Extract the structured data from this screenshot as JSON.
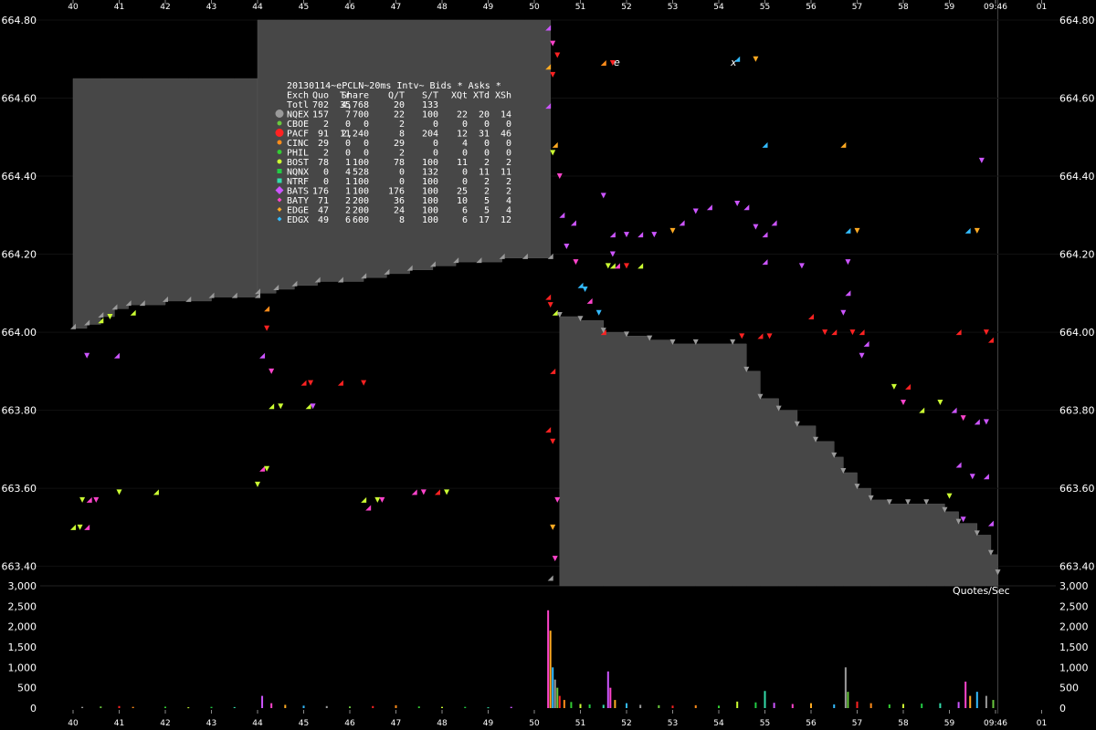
{
  "chart_data": {
    "type": "scatter",
    "x_ticks": [
      "40",
      "41",
      "42",
      "43",
      "44",
      "45",
      "46",
      "47",
      "48",
      "49",
      "50",
      "51",
      "52",
      "53",
      "54",
      "55",
      "56",
      "57",
      "58",
      "59",
      "09:46",
      "01"
    ],
    "price_ticks": [
      "664.80",
      "664.60",
      "664.40",
      "664.20",
      "664.00",
      "663.80",
      "663.60",
      "663.40"
    ],
    "volume_ticks": [
      "3,000",
      "2,500",
      "2,000",
      "1,500",
      "1,000",
      "500",
      "0"
    ],
    "price_range": [
      663.35,
      664.8
    ],
    "volume_range": [
      0,
      3000
    ],
    "volume_label": "Quotes/Sec",
    "watermark": [
      "e",
      "x"
    ],
    "exchange_colors": {
      "NQEX": "#9a9a9a",
      "CBOE": "#6ac83e",
      "PACF": "#ff2222",
      "CINC": "#ff8c1a",
      "PHIL": "#33cc33",
      "BOST": "#ccff33",
      "NQNX": "#22cc44",
      "NTRF": "#33ddaa",
      "BATS": "#cc55ff",
      "BATY": "#ff44cc",
      "EDGE": "#ffaa22",
      "EDGX": "#33bbff"
    },
    "legend": {
      "title": "20130114~ePCLN~20ms Intv~ Bids * Asks *",
      "header": [
        "Exch",
        "Quo",
        "Tr",
        "Share",
        "Q/T",
        "S/T",
        "XQt",
        "XTd",
        "XSh"
      ],
      "total": [
        "Totl",
        "702",
        "35",
        "4,768",
        "20",
        "133",
        "",
        "",
        ""
      ],
      "rows": [
        [
          "NQEX",
          "157",
          "7",
          "700",
          "22",
          "100",
          "22",
          "20",
          "14"
        ],
        [
          "CBOE",
          "2",
          "0",
          "0",
          "2",
          "0",
          "0",
          "0",
          "0"
        ],
        [
          "PACF",
          "91",
          "11",
          "2,240",
          "8",
          "204",
          "12",
          "31",
          "46"
        ],
        [
          "CINC",
          "29",
          "0",
          "0",
          "29",
          "0",
          "4",
          "0",
          "0"
        ],
        [
          "PHIL",
          "2",
          "0",
          "0",
          "2",
          "0",
          "0",
          "0",
          "0"
        ],
        [
          "BOST",
          "78",
          "1",
          "100",
          "78",
          "100",
          "11",
          "2",
          "2"
        ],
        [
          "NQNX",
          "0",
          "4",
          "528",
          "0",
          "132",
          "0",
          "11",
          "11"
        ],
        [
          "NTRF",
          "0",
          "1",
          "100",
          "0",
          "100",
          "0",
          "2",
          "2"
        ],
        [
          "BATS",
          "176",
          "1",
          "100",
          "176",
          "100",
          "25",
          "2",
          "2"
        ],
        [
          "BATY",
          "71",
          "2",
          "200",
          "36",
          "100",
          "10",
          "5",
          "4"
        ],
        [
          "EDGE",
          "47",
          "2",
          "200",
          "24",
          "100",
          "6",
          "5",
          "4"
        ],
        [
          "EDGX",
          "49",
          "6",
          "600",
          "8",
          "100",
          "6",
          "17",
          "12"
        ]
      ]
    },
    "spread_left": [
      [
        40.0,
        664.01,
        664.65
      ],
      [
        40.3,
        664.02,
        664.65
      ],
      [
        40.6,
        664.04,
        664.65
      ],
      [
        40.9,
        664.06,
        664.65
      ],
      [
        41.2,
        664.07,
        664.65
      ],
      [
        41.5,
        664.07,
        664.65
      ],
      [
        42.0,
        664.08,
        664.65
      ],
      [
        42.5,
        664.08,
        664.65
      ],
      [
        43.0,
        664.09,
        664.65
      ],
      [
        43.5,
        664.09,
        664.65
      ],
      [
        44.0,
        664.09,
        664.65
      ]
    ],
    "spread_mid": [
      [
        44.0,
        664.1,
        664.8
      ],
      [
        44.4,
        664.11,
        664.8
      ],
      [
        44.8,
        664.12,
        664.8
      ],
      [
        45.3,
        664.13,
        664.8
      ],
      [
        45.8,
        664.13,
        664.8
      ],
      [
        46.3,
        664.14,
        664.8
      ],
      [
        46.8,
        664.15,
        664.8
      ],
      [
        47.3,
        664.16,
        664.8
      ],
      [
        47.8,
        664.17,
        664.8
      ],
      [
        48.3,
        664.18,
        664.8
      ],
      [
        48.8,
        664.18,
        664.8
      ],
      [
        49.3,
        664.19,
        664.8
      ],
      [
        49.8,
        664.19,
        664.8
      ],
      [
        50.35,
        664.19,
        664.8
      ]
    ],
    "spread_right": [
      [
        50.55,
        663.35,
        664.04
      ],
      [
        51.0,
        663.35,
        664.03
      ],
      [
        51.5,
        663.35,
        664.0
      ],
      [
        52.0,
        663.35,
        663.99
      ],
      [
        52.5,
        663.35,
        663.98
      ],
      [
        53.0,
        663.35,
        663.97
      ],
      [
        53.5,
        663.35,
        663.97
      ],
      [
        54.3,
        663.35,
        663.97
      ],
      [
        54.6,
        663.35,
        663.9
      ],
      [
        54.9,
        663.35,
        663.83
      ],
      [
        55.3,
        663.35,
        663.8
      ],
      [
        55.7,
        663.35,
        663.76
      ],
      [
        56.1,
        663.35,
        663.72
      ],
      [
        56.5,
        663.35,
        663.68
      ],
      [
        56.7,
        663.35,
        663.64
      ],
      [
        57.0,
        663.35,
        663.6
      ],
      [
        57.3,
        663.35,
        663.57
      ],
      [
        57.7,
        663.35,
        663.56
      ],
      [
        58.1,
        663.35,
        663.56
      ],
      [
        58.5,
        663.35,
        663.56
      ],
      [
        58.9,
        663.35,
        663.54
      ],
      [
        59.2,
        663.35,
        663.51
      ],
      [
        59.6,
        663.35,
        663.48
      ],
      [
        59.9,
        663.35,
        663.43
      ],
      [
        60.05,
        663.35,
        663.38
      ]
    ],
    "quotes": [
      [
        40.0,
        663.5,
        "BOST"
      ],
      [
        40.15,
        663.5,
        "BOST"
      ],
      [
        40.3,
        663.5,
        "BATY"
      ],
      [
        40.2,
        663.57,
        "BOST"
      ],
      [
        40.35,
        663.57,
        "BATY"
      ],
      [
        40.5,
        663.57,
        "BATY"
      ],
      [
        40.6,
        664.03,
        "BOST"
      ],
      [
        40.8,
        664.04,
        "BOST"
      ],
      [
        41.3,
        664.05,
        "BOST"
      ],
      [
        40.3,
        663.94,
        "BATS"
      ],
      [
        40.95,
        663.94,
        "BATS"
      ],
      [
        41.0,
        663.59,
        "BOST"
      ],
      [
        41.8,
        663.59,
        "BOST"
      ],
      [
        44.0,
        663.61,
        "BOST"
      ],
      [
        44.1,
        663.65,
        "BATY"
      ],
      [
        44.2,
        663.65,
        "BOST"
      ],
      [
        44.1,
        663.94,
        "BATS"
      ],
      [
        44.2,
        664.01,
        "PACF"
      ],
      [
        44.2,
        664.06,
        "CINC"
      ],
      [
        44.3,
        663.9,
        "BATY"
      ],
      [
        44.3,
        663.81,
        "BOST"
      ],
      [
        44.5,
        663.81,
        "BOST"
      ],
      [
        45.1,
        663.81,
        "BOST"
      ],
      [
        45.2,
        663.81,
        "BATS"
      ],
      [
        45.0,
        663.87,
        "PACF"
      ],
      [
        45.15,
        663.87,
        "PACF"
      ],
      [
        45.8,
        663.87,
        "PACF"
      ],
      [
        46.3,
        663.87,
        "PACF"
      ],
      [
        46.3,
        663.57,
        "BOST"
      ],
      [
        46.6,
        663.57,
        "BOST"
      ],
      [
        46.4,
        663.55,
        "BATY"
      ],
      [
        46.7,
        663.57,
        "BATY"
      ],
      [
        47.4,
        663.59,
        "BATY"
      ],
      [
        47.6,
        663.59,
        "BATY"
      ],
      [
        47.9,
        663.59,
        "PACF"
      ],
      [
        48.1,
        663.59,
        "BOST"
      ],
      [
        50.3,
        664.09,
        "PACF"
      ],
      [
        50.35,
        664.07,
        "PACF"
      ],
      [
        50.45,
        664.05,
        "BOST"
      ],
      [
        50.4,
        663.72,
        "PACF"
      ],
      [
        50.3,
        663.75,
        "PACF"
      ],
      [
        50.4,
        663.5,
        "EDGE"
      ],
      [
        50.35,
        663.37,
        "NQEX"
      ],
      [
        50.4,
        664.46,
        "BOST"
      ],
      [
        50.45,
        664.48,
        "EDGE"
      ],
      [
        50.55,
        664.4,
        "BATY"
      ],
      [
        50.6,
        664.3,
        "BATS"
      ],
      [
        50.7,
        664.22,
        "BATS"
      ],
      [
        50.85,
        664.28,
        "BATS"
      ],
      [
        50.9,
        664.18,
        "BATY"
      ],
      [
        51.0,
        664.12,
        "EDGX"
      ],
      [
        51.1,
        664.11,
        "EDGX"
      ],
      [
        51.2,
        664.08,
        "BATY"
      ],
      [
        51.4,
        664.05,
        "EDGX"
      ],
      [
        51.5,
        664.0,
        "PACF"
      ],
      [
        51.6,
        664.17,
        "BOST"
      ],
      [
        51.7,
        664.17,
        "BOST"
      ],
      [
        51.7,
        664.2,
        "BATS"
      ],
      [
        51.8,
        664.17,
        "BATY"
      ],
      [
        52.0,
        664.17,
        "PACF"
      ],
      [
        52.3,
        664.17,
        "BOST"
      ],
      [
        51.7,
        664.69,
        "PACF"
      ],
      [
        51.5,
        664.69,
        "CINC"
      ],
      [
        51.5,
        664.35,
        "BATS"
      ],
      [
        51.7,
        664.25,
        "BATS"
      ],
      [
        52.0,
        664.25,
        "BATS"
      ],
      [
        52.3,
        664.25,
        "BATS"
      ],
      [
        52.6,
        664.25,
        "BATS"
      ],
      [
        53.2,
        664.28,
        "BATS"
      ],
      [
        53.5,
        664.31,
        "BATS"
      ],
      [
        53.8,
        664.32,
        "BATS"
      ],
      [
        54.4,
        664.33,
        "BATS"
      ],
      [
        54.6,
        664.32,
        "BATS"
      ],
      [
        54.8,
        664.27,
        "BATS"
      ],
      [
        55.0,
        664.25,
        "BATS"
      ],
      [
        54.5,
        663.99,
        "PACF"
      ],
      [
        54.9,
        663.99,
        "PACF"
      ],
      [
        55.1,
        663.99,
        "PACF"
      ],
      [
        55.0,
        664.18,
        "BATS"
      ],
      [
        55.8,
        664.17,
        "BATS"
      ],
      [
        56.0,
        664.04,
        "PACF"
      ],
      [
        56.3,
        664.0,
        "PACF"
      ],
      [
        56.5,
        664.0,
        "PACF"
      ],
      [
        56.9,
        664.0,
        "PACF"
      ],
      [
        57.1,
        664.0,
        "PACF"
      ],
      [
        56.7,
        664.05,
        "BATS"
      ],
      [
        56.8,
        664.1,
        "BATS"
      ],
      [
        56.8,
        664.18,
        "BATS"
      ],
      [
        56.8,
        664.26,
        "EDGX"
      ],
      [
        57.0,
        664.26,
        "EDGE"
      ],
      [
        56.7,
        664.48,
        "EDGE"
      ],
      [
        57.1,
        663.94,
        "BATS"
      ],
      [
        57.2,
        663.97,
        "BATS"
      ],
      [
        57.8,
        663.86,
        "BOST"
      ],
      [
        58.1,
        663.86,
        "PACF"
      ],
      [
        58.0,
        663.82,
        "BATY"
      ],
      [
        58.4,
        663.8,
        "BOST"
      ],
      [
        58.8,
        663.82,
        "BOST"
      ],
      [
        59.1,
        663.8,
        "BATS"
      ],
      [
        59.3,
        663.78,
        "BATY"
      ],
      [
        59.6,
        663.77,
        "BATS"
      ],
      [
        59.8,
        663.77,
        "BATS"
      ],
      [
        59.2,
        663.66,
        "BATS"
      ],
      [
        59.5,
        663.63,
        "BATS"
      ],
      [
        59.8,
        663.63,
        "BATS"
      ],
      [
        59.3,
        663.52,
        "BATS"
      ],
      [
        59.9,
        663.51,
        "BATS"
      ],
      [
        59.0,
        663.58,
        "BOST"
      ],
      [
        59.2,
        664.0,
        "PACF"
      ],
      [
        59.8,
        664.0,
        "PACF"
      ],
      [
        59.9,
        663.98,
        "PACF"
      ],
      [
        59.7,
        664.44,
        "BATS"
      ],
      [
        59.4,
        664.26,
        "EDGX"
      ],
      [
        59.6,
        664.26,
        "EDGE"
      ],
      [
        54.4,
        664.7,
        "EDGX"
      ],
      [
        54.8,
        664.7,
        "EDGE"
      ],
      [
        55.0,
        664.48,
        "EDGX"
      ],
      [
        53.0,
        664.26,
        "EDGE"
      ],
      [
        55.2,
        664.28,
        "BATS"
      ],
      [
        50.5,
        664.71,
        "PACF"
      ],
      [
        50.3,
        664.68,
        "EDGE"
      ],
      [
        50.4,
        664.66,
        "PACF"
      ],
      [
        50.3,
        664.78,
        "BATS"
      ],
      [
        50.4,
        664.74,
        "BATY"
      ],
      [
        50.3,
        664.58,
        "BATS"
      ],
      [
        50.5,
        663.57,
        "BATY"
      ],
      [
        50.4,
        663.9,
        "PACF"
      ],
      [
        50.45,
        663.42,
        "BATY"
      ]
    ],
    "volume_bars": [
      [
        40.2,
        30
      ],
      [
        40.6,
        40
      ],
      [
        41.0,
        50
      ],
      [
        41.3,
        30
      ],
      [
        42.0,
        35
      ],
      [
        42.5,
        20
      ],
      [
        43.0,
        30
      ],
      [
        43.5,
        25
      ],
      [
        44.1,
        300
      ],
      [
        44.3,
        120
      ],
      [
        44.6,
        80
      ],
      [
        45.0,
        60
      ],
      [
        45.5,
        50
      ],
      [
        46.0,
        40
      ],
      [
        46.5,
        50
      ],
      [
        47.0,
        70
      ],
      [
        47.5,
        40
      ],
      [
        48.0,
        30
      ],
      [
        48.5,
        30
      ],
      [
        49.0,
        20
      ],
      [
        49.5,
        30
      ],
      [
        50.3,
        2400
      ],
      [
        50.35,
        1900
      ],
      [
        50.4,
        1000
      ],
      [
        50.45,
        700
      ],
      [
        50.5,
        500
      ],
      [
        50.55,
        300
      ],
      [
        50.65,
        200
      ],
      [
        50.8,
        150
      ],
      [
        51.0,
        100
      ],
      [
        51.2,
        90
      ],
      [
        51.5,
        80
      ],
      [
        51.6,
        900
      ],
      [
        51.65,
        500
      ],
      [
        51.75,
        200
      ],
      [
        52.0,
        120
      ],
      [
        52.3,
        80
      ],
      [
        52.7,
        70
      ],
      [
        53.0,
        60
      ],
      [
        53.5,
        70
      ],
      [
        54.0,
        60
      ],
      [
        54.4,
        160
      ],
      [
        54.8,
        140
      ],
      [
        55.0,
        420
      ],
      [
        55.2,
        130
      ],
      [
        55.6,
        100
      ],
      [
        56.0,
        120
      ],
      [
        56.5,
        90
      ],
      [
        56.75,
        1000
      ],
      [
        56.8,
        400
      ],
      [
        57.0,
        160
      ],
      [
        57.3,
        120
      ],
      [
        57.7,
        90
      ],
      [
        58.0,
        100
      ],
      [
        58.4,
        110
      ],
      [
        58.8,
        120
      ],
      [
        59.2,
        150
      ],
      [
        59.35,
        650
      ],
      [
        59.45,
        300
      ],
      [
        59.6,
        400
      ],
      [
        59.8,
        300
      ],
      [
        59.95,
        200
      ]
    ]
  }
}
